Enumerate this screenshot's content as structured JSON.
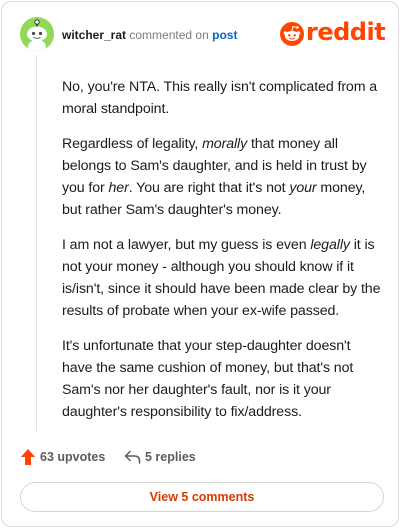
{
  "comment": {
    "username": "witcher_rat",
    "action_text": "commented on",
    "post_link": "post",
    "paragraphs": [
      [
        {
          "text": "No, you're NTA. This really isn't complicated from a moral standpoint.",
          "italic": false
        }
      ],
      [
        {
          "text": "Regardless of legality, ",
          "italic": false
        },
        {
          "text": "morally",
          "italic": true
        },
        {
          "text": " that money all belongs to Sam's daughter, and is held in trust by you for ",
          "italic": false
        },
        {
          "text": "her",
          "italic": true
        },
        {
          "text": ". You are right that it's not ",
          "italic": false
        },
        {
          "text": "your",
          "italic": true
        },
        {
          "text": " money, but rather Sam's daughter's money.",
          "italic": false
        }
      ],
      [
        {
          "text": "I am not a lawyer, but my guess is even ",
          "italic": false
        },
        {
          "text": "legally",
          "italic": true
        },
        {
          "text": " it is not your money - although you should know if it is/isn't, since it should have been made clear by the results of probate when your ex-wife passed.",
          "italic": false
        }
      ],
      [
        {
          "text": "It's unfortunate that your step-daughter doesn't have the same cushion of money, but that's not Sam's nor her daughter's fault, nor is it your daughter's responsibility to fix/address.",
          "italic": false
        }
      ]
    ]
  },
  "brand": {
    "wordmark": "reddit",
    "color": "#ff4500"
  },
  "actions": {
    "upvotes_label": "63 upvotes",
    "replies_label": "5 replies"
  },
  "footer": {
    "view_comments_label": "View 5 comments"
  },
  "icons": {
    "avatar": "snoo-avatar-icon",
    "logo": "reddit-alien-icon",
    "upvote": "upvote-arrow-icon",
    "reply": "reply-arrow-icon"
  },
  "colors": {
    "avatar_bg": "#94d85a",
    "link": "#0a66c2",
    "upvote": "#ff4500",
    "view_button_text": "#d93a00"
  }
}
